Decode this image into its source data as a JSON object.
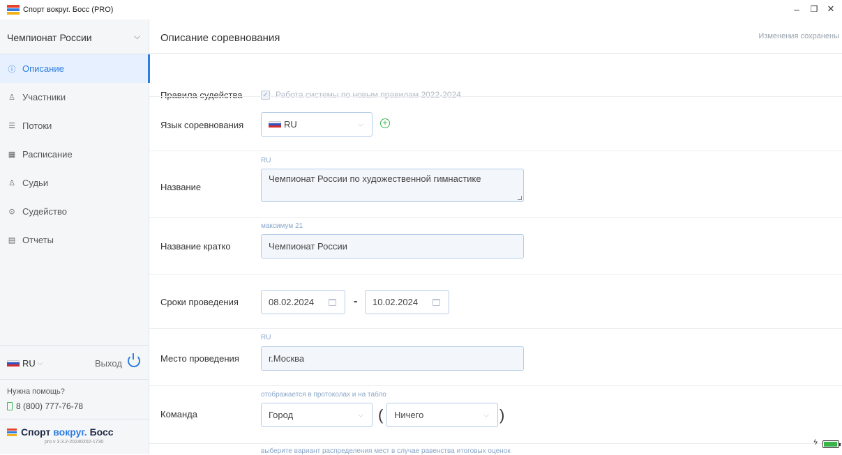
{
  "window": {
    "title": "Спорт вокруг. Босс (PRO)",
    "controls": {
      "minimize": "–",
      "maximize": "❐",
      "close": "✕"
    }
  },
  "sidebar": {
    "competition": "Чемпионат России",
    "items": [
      {
        "label": "Описание",
        "icon": "info-icon",
        "active": true
      },
      {
        "label": "Участники",
        "icon": "participants-icon",
        "active": false
      },
      {
        "label": "Потоки",
        "icon": "list-icon",
        "active": false
      },
      {
        "label": "Расписание",
        "icon": "calendar-icon",
        "active": false
      },
      {
        "label": "Судьи",
        "icon": "judges-icon",
        "active": false
      },
      {
        "label": "Судейство",
        "icon": "play-circle-icon",
        "active": false
      },
      {
        "label": "Отчеты",
        "icon": "document-icon",
        "active": false
      }
    ],
    "language": "RU",
    "exit_label": "Выход",
    "help_question": "Нужна помощь?",
    "help_phone": "8 (800) 777-76-78",
    "brand": {
      "part1": "Спорт ",
      "part2": "вокруг.",
      "part3": " Босс"
    },
    "version": "pro v 3.3.2-20240202-1730"
  },
  "main": {
    "title": "Описание соревнования",
    "save_status": "Изменения сохранены",
    "rules": {
      "label": "Правила судейства",
      "checkbox_text": "Работа системы по новым правилам 2022-2024",
      "checked": true
    },
    "language": {
      "label": "Язык соревнования",
      "value": "RU"
    },
    "name": {
      "label": "Название",
      "hint": "RU",
      "value": "Чемпионат России по художественной гимнастике"
    },
    "short_name": {
      "label": "Название кратко",
      "hint": "максимум 21",
      "value": "Чемпионат России"
    },
    "dates": {
      "label": "Сроки проведения",
      "start": "08.02.2024",
      "separator": "-",
      "end": "10.02.2024"
    },
    "venue": {
      "label": "Место проведения",
      "hint": "RU",
      "value": "г.Москва"
    },
    "team": {
      "label": "Команда",
      "hint": "отображается в протоколах и на табло",
      "primary": "Город",
      "secondary": "Ничего",
      "open_paren": "(",
      "close_paren": ")"
    },
    "tie_hint": "выберите вариант распределения мест в случае равенства итоговых оценок"
  },
  "colors": {
    "accent": "#2f7de1",
    "green": "#3ab54a",
    "sidebar_bg": "#f5f6f8",
    "input_border": "#b6cde8"
  }
}
